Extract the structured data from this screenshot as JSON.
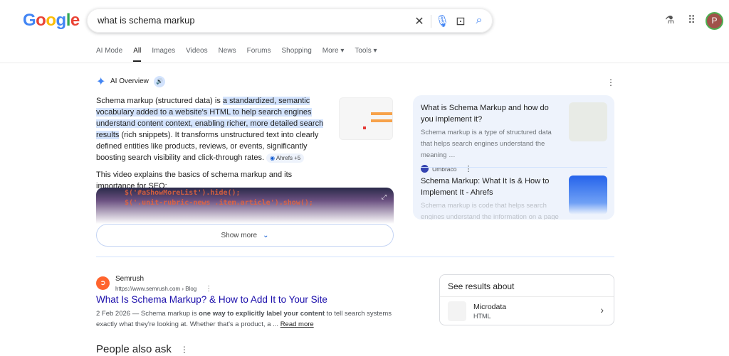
{
  "header": {
    "logo": "Google",
    "query": "what is schema markup",
    "avatar_letter": "P",
    "icons": [
      "clear-icon",
      "mic-icon",
      "lens-icon",
      "search-icon",
      "labs-icon",
      "apps-icon"
    ]
  },
  "tabs": [
    {
      "label": "AI Mode"
    },
    {
      "label": "All",
      "active": true
    },
    {
      "label": "Images"
    },
    {
      "label": "Videos"
    },
    {
      "label": "News"
    },
    {
      "label": "Forums"
    },
    {
      "label": "Shopping"
    },
    {
      "label": "More ▾"
    },
    {
      "label": "Tools ▾"
    }
  ],
  "ai_overview": {
    "title": "AI Overview",
    "text_pre": "Schema markup (structured data) is ",
    "text_highlight": "a standardized, semantic vocabulary added to a website's HTML to help search engines understand content context, enabling richer, more detailed search results",
    "text_post": " (rich snippets). It transforms unstructured text into clearly defined entities like products, reviews, or events, significantly boosting search visibility and click-through rates.",
    "source_chip": "Ahrefs +5",
    "video_intro": "This video explains the basics of schema markup and its importance for SEO:",
    "video_code_1": "$('#aShowMoreList').hide();",
    "video_code_2": "$('.unit-rubric-news .item.article').show();",
    "show_more": "Show more"
  },
  "sources": [
    {
      "title": "What is Schema Markup and how do you implement it?",
      "snippet": "Schema markup is a type of structured data that helps search engines understand the meaning …",
      "site": "Umbraco"
    },
    {
      "title": "Schema Markup: What It Is & How to Implement It - Ahrefs",
      "snippet": "Schema markup is code that helps search engines understand the information on a page"
    }
  ],
  "result": {
    "site": "Semrush",
    "url": "https://www.semrush.com › Blog",
    "title": "What Is Schema Markup? & How to Add It to Your Site",
    "date": "2 Feb 2026",
    "snippet_a": " — Schema markup is ",
    "snippet_bold": "one way to explicitly label your content",
    "snippet_b": " to tell search systems exactly what they're looking at. Whether that's a product, a ... ",
    "read_more": "Read more",
    "brand_color": "#ff642d"
  },
  "see_results": {
    "title": "See results about",
    "item": "Microdata",
    "sub": "HTML"
  },
  "people_also_ask": "People also ask"
}
